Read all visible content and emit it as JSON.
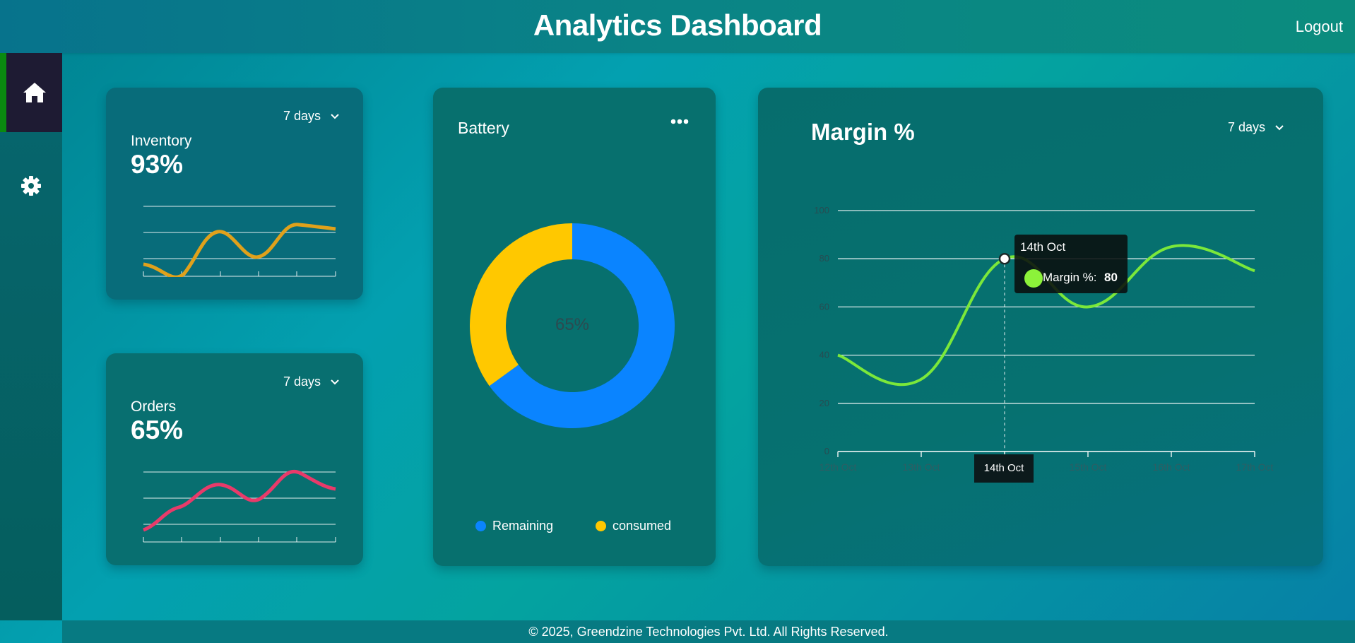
{
  "header": {
    "title": "Analytics Dashboard",
    "logout_label": "Logout"
  },
  "sidebar": {
    "items": [
      {
        "name": "home",
        "icon": "home-icon",
        "active": true
      },
      {
        "name": "settings",
        "icon": "gear-icon",
        "active": false
      }
    ]
  },
  "cards": {
    "inventory": {
      "range": "7 days",
      "label": "Inventory",
      "value": "93%",
      "line_color": "#e0a11b"
    },
    "orders": {
      "range": "7 days",
      "label": "Orders",
      "value": "65%",
      "line_color": "#e83a6a"
    }
  },
  "battery": {
    "title": "Battery",
    "center_text": "65%",
    "legend": [
      {
        "label": "Remaining",
        "color": "#0a84ff"
      },
      {
        "label": "consumed",
        "color": "#ffc800"
      }
    ]
  },
  "margin": {
    "title": "Margin %",
    "range": "7 days",
    "tooltip": {
      "title": "14th Oct",
      "series": "Margin %:",
      "value": "80"
    },
    "x_tooltip": "14th Oct"
  },
  "chart_data": [
    {
      "type": "pie",
      "title": "Battery",
      "labels": [
        "Remaining",
        "consumed"
      ],
      "values": [
        65,
        35
      ],
      "colors": [
        "#0a84ff",
        "#ffc800"
      ],
      "donut": true
    },
    {
      "type": "line",
      "title": "Margin %",
      "categories": [
        "12th Oct",
        "13th Oct",
        "14th Oct",
        "15th Oct",
        "16th Oct",
        "17th Oct"
      ],
      "series": [
        {
          "name": "Margin %",
          "values": [
            40,
            30,
            80,
            60,
            85,
            75
          ],
          "color": "#7be83a"
        }
      ],
      "yticks": [
        0,
        20,
        40,
        60,
        80,
        100
      ],
      "ylim": [
        0,
        100
      ],
      "grid": true,
      "highlight": "14th Oct"
    }
  ],
  "footer": {
    "text": "© 2025, Greendzine Technologies Pvt. Ltd. All Rights Reserved."
  }
}
